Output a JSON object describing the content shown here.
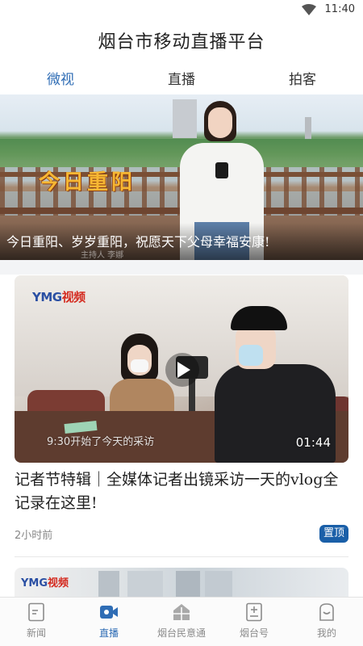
{
  "status_bar": {
    "time": "11:40",
    "wifi_icon": "wifi-icon"
  },
  "header": {
    "title": "烟台市移动直播平台"
  },
  "tabs": [
    {
      "label": "微视",
      "active": true
    },
    {
      "label": "直播",
      "active": false
    },
    {
      "label": "拍客",
      "active": false
    }
  ],
  "banner": {
    "calligraphy": "今日重阳",
    "caption": "今日重阳、岁岁重阳，祝愿天下父母幸福安康!",
    "subcaption": "主持人 李娜"
  },
  "video_card": {
    "logo_main": "YMG",
    "logo_accent": "视频",
    "subtitle": "9:30开始了今天的采访",
    "duration": "01:44",
    "title": "记者节特辑｜全媒体记者出镜采访一天的vlog全记录在这里!",
    "time_ago": "2小时前",
    "badge": "置顶"
  },
  "video_card2": {
    "logo_main": "YMG",
    "logo_accent": "视频"
  },
  "bottom_nav": [
    {
      "label": "新闻",
      "icon": "news-icon",
      "active": false
    },
    {
      "label": "直播",
      "icon": "live-video-icon",
      "active": true
    },
    {
      "label": "烟台民意通",
      "icon": "public-opinion-icon",
      "active": false
    },
    {
      "label": "烟台号",
      "icon": "yantai-account-icon",
      "active": false
    },
    {
      "label": "我的",
      "icon": "profile-icon",
      "active": false
    }
  ],
  "colors": {
    "accent": "#2f6db5",
    "badge": "#1a5fa8",
    "logo_blue": "#2a4fa3",
    "logo_red": "#d42a1f"
  }
}
